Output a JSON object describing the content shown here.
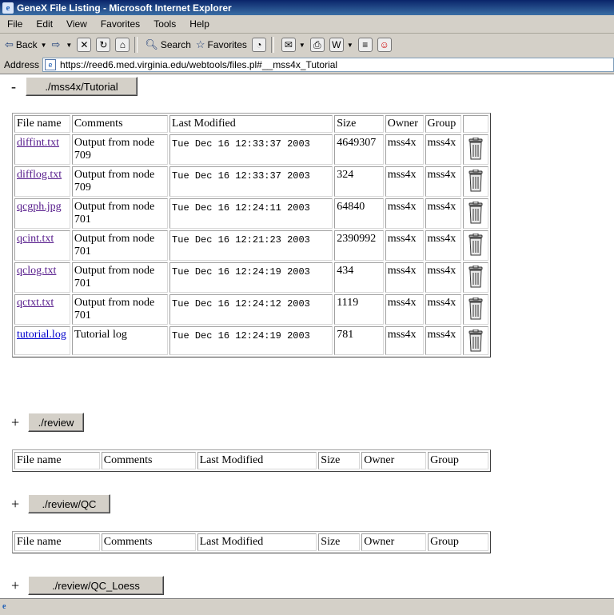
{
  "window": {
    "title": "GeneX File Listing - Microsoft Internet Explorer"
  },
  "menu": [
    "File",
    "Edit",
    "View",
    "Favorites",
    "Tools",
    "Help"
  ],
  "toolbar": {
    "back": "Back",
    "search": "Search",
    "favorites": "Favorites"
  },
  "address": {
    "label": "Address",
    "url": "https://reed6.med.virginia.edu/webtools/files.pl#__mss4x_Tutorial"
  },
  "columns": [
    "File name",
    "Comments",
    "Last Modified",
    "Size",
    "Owner",
    "Group"
  ],
  "sections": [
    {
      "toggle": "-",
      "label": "./mss4x/Tutorial",
      "files": [
        {
          "name": "diffint.txt",
          "comment": "Output from node 709",
          "modified": "Tue Dec 16 12:33:37 2003",
          "size": "4649307",
          "owner": "mss4x",
          "group": "mss4x"
        },
        {
          "name": "difflog.txt",
          "comment": "Output from node 709",
          "modified": "Tue Dec 16 12:33:37 2003",
          "size": "324",
          "owner": "mss4x",
          "group": "mss4x"
        },
        {
          "name": "qcgph.jpg",
          "comment": "Output from node 701",
          "modified": "Tue Dec 16 12:24:11 2003",
          "size": "64840",
          "owner": "mss4x",
          "group": "mss4x"
        },
        {
          "name": "qcint.txt",
          "comment": "Output from node 701",
          "modified": "Tue Dec 16 12:21:23 2003",
          "size": "2390992",
          "owner": "mss4x",
          "group": "mss4x"
        },
        {
          "name": "qclog.txt",
          "comment": "Output from node 701",
          "modified": "Tue Dec 16 12:24:19 2003",
          "size": "434",
          "owner": "mss4x",
          "group": "mss4x"
        },
        {
          "name": "qctxt.txt",
          "comment": "Output from node 701",
          "modified": "Tue Dec 16 12:24:12 2003",
          "size": "1119",
          "owner": "mss4x",
          "group": "mss4x"
        },
        {
          "name": "tutorial.log",
          "comment": "Tutorial log",
          "modified": "Tue Dec 16 12:24:19 2003",
          "size": "781",
          "owner": "mss4x",
          "group": "mss4x"
        }
      ]
    },
    {
      "toggle": "+",
      "label": "./review"
    },
    {
      "toggle": "+",
      "label": "./review/QC"
    },
    {
      "toggle": "+",
      "label": "./review/QC_Loess"
    }
  ],
  "icons": {
    "delete": "trash-can-icon",
    "page": "page-icon",
    "browser": "ie-logo-icon"
  },
  "colors": {
    "titlebar": "#0a246a",
    "chrome": "#d4d0c8",
    "visited_link": "#551a8b",
    "link": "#0000cc"
  }
}
